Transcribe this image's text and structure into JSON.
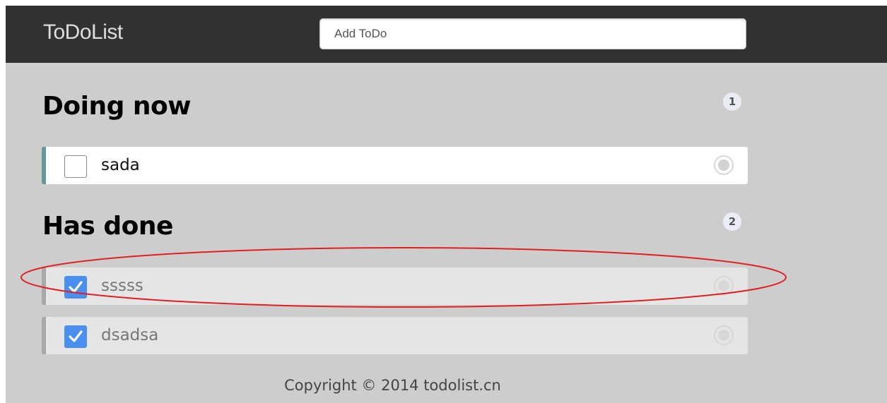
{
  "header": {
    "brand": "ToDoList",
    "add_todo_placeholder": "Add ToDo",
    "add_todo_value": ""
  },
  "sections": {
    "doing": {
      "title": "Doing now",
      "count": "1",
      "items": [
        {
          "text": "sada",
          "checked": false
        }
      ]
    },
    "done": {
      "title": "Has done",
      "count": "2",
      "items": [
        {
          "text": "sssss",
          "checked": true
        },
        {
          "text": "dsadsa",
          "checked": true
        }
      ]
    }
  },
  "footer": {
    "copyright": "Copyright © 2014 todolist.cn"
  },
  "colors": {
    "header_bg": "#323232",
    "page_bg": "#cdcdcd",
    "active_accent": "#629a9c",
    "done_accent": "#a8a8a8",
    "checkbox_checked": "#4a8ef0",
    "annotation": "#e02020"
  },
  "icons": {
    "check": "check-icon",
    "delete": "delete-circle-icon"
  }
}
